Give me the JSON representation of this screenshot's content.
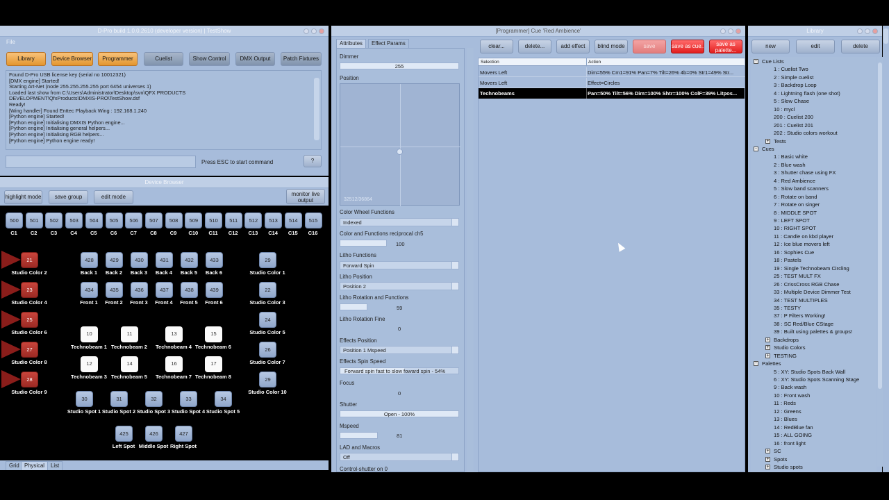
{
  "main_window": {
    "title": "D-Pro build 1.0.0.2610 (developer version) | TestShow",
    "menu_file": "File",
    "toolbar": [
      "Library",
      "Device Browser",
      "Programmer",
      "Cuelist",
      "Show Control",
      "DMX Output",
      "Patch Fixtures"
    ],
    "log": [
      "Found D-Pro USB license key (serial no 10012321)",
      "[DMX engine] Started!",
      "Starting Art-Net (node 255.255.255.255 port 6454 universes 1)",
      "Loaded last show from C:\\Users\\Administrator\\Desktop\\svn\\QFX PRODUCTS",
      "DEVELOPMENT\\QfxProducts\\DMXIS-PRO\\TestShow.dsf",
      "Ready!",
      "[Wing handler] Found Enttec Playback Wing : 192.168.1.240",
      "[Python engine] Started!",
      "[Python engine] Initialising DMXIS Python engine...",
      "[Python engine] Initialising general helpers...",
      "[Python engine] Initialising RGB helpers...",
      "[Python engine] Python engine ready!"
    ],
    "command_hint": "Press ESC to start command",
    "help_label": "?"
  },
  "device_browser": {
    "title": "Device Browser",
    "buttons": {
      "highlight": "highlight mode",
      "save_group": "save group",
      "edit_mode": "edit mode",
      "monitor": "monitor live output"
    },
    "top_row": [
      {
        "id": "500",
        "label": "C1"
      },
      {
        "id": "501",
        "label": "C2"
      },
      {
        "id": "502",
        "label": "C3"
      },
      {
        "id": "503",
        "label": "C4"
      },
      {
        "id": "504",
        "label": "C5"
      },
      {
        "id": "505",
        "label": "C6"
      },
      {
        "id": "506",
        "label": "C7"
      },
      {
        "id": "507",
        "label": "C8"
      },
      {
        "id": "508",
        "label": "C9"
      },
      {
        "id": "509",
        "label": "C10"
      },
      {
        "id": "510",
        "label": "C11"
      },
      {
        "id": "511",
        "label": "C12"
      },
      {
        "id": "512",
        "label": "C13"
      },
      {
        "id": "513",
        "label": "C14"
      },
      {
        "id": "514",
        "label": "C15"
      },
      {
        "id": "515",
        "label": "C16"
      }
    ],
    "left_col": [
      {
        "id": "21",
        "label": "Studio Color 2"
      },
      {
        "id": "23",
        "label": "Studio Color 4"
      },
      {
        "id": "25",
        "label": "Studio Color 6"
      },
      {
        "id": "27",
        "label": "Studio Color 8"
      },
      {
        "id": "28",
        "label": "Studio Color 9"
      }
    ],
    "back_row": [
      {
        "id": "428",
        "label": "Back 1"
      },
      {
        "id": "429",
        "label": "Back 2"
      },
      {
        "id": "430",
        "label": "Back 3"
      },
      {
        "id": "431",
        "label": "Back 4"
      },
      {
        "id": "432",
        "label": "Back 5"
      },
      {
        "id": "433",
        "label": "Back 6"
      }
    ],
    "front_row": [
      {
        "id": "434",
        "label": "Front 1"
      },
      {
        "id": "435",
        "label": "Front 2"
      },
      {
        "id": "436",
        "label": "Front 3"
      },
      {
        "id": "437",
        "label": "Front 4"
      },
      {
        "id": "438",
        "label": "Front 5"
      },
      {
        "id": "439",
        "label": "Front 6"
      }
    ],
    "right_col": [
      {
        "id": "29",
        "label": "Studio Color 1"
      },
      {
        "id": "22",
        "label": "Studio Color 3"
      },
      {
        "id": "24",
        "label": "Studio Color 5"
      },
      {
        "id": "26",
        "label": "Studio Color 7"
      },
      {
        "id": "29",
        "label": "Studio Color 10"
      }
    ],
    "techno_row1": [
      {
        "id": "10",
        "label": "Technobeam 1"
      },
      {
        "id": "11",
        "label": "Technobeam 2"
      },
      {
        "id": "13",
        "label": "Technobeam 4"
      },
      {
        "id": "15",
        "label": "Technobeam 6"
      }
    ],
    "techno_row2": [
      {
        "id": "12",
        "label": "Technobeam 3"
      },
      {
        "id": "14",
        "label": "Technobeam 5"
      },
      {
        "id": "16",
        "label": "Technobeam 7"
      },
      {
        "id": "17",
        "label": "Technobeam 8"
      }
    ],
    "spots": [
      {
        "id": "30",
        "label": "Studio Spot 1"
      },
      {
        "id": "31",
        "label": "Studio Spot 2"
      },
      {
        "id": "32",
        "label": "Studio Spot 3"
      },
      {
        "id": "33",
        "label": "Studio Spot 4"
      },
      {
        "id": "34",
        "label": "Studio Spot 5"
      }
    ],
    "lr_spots": [
      {
        "id": "425",
        "label": "Left Spot"
      },
      {
        "id": "426",
        "label": "Middle Spot"
      },
      {
        "id": "427",
        "label": "Right Spot"
      }
    ],
    "tabs": [
      "Grid",
      "Physical",
      "List"
    ]
  },
  "programmer": {
    "title": "[Programmer] Cue 'Red Ambience'",
    "tabs": [
      "Attributes",
      "Effect Params"
    ],
    "dimmer": {
      "label": "Dimmer",
      "value": "255"
    },
    "position": {
      "label": "Position",
      "readout": "32512/36864"
    },
    "color_wheel": {
      "label": "Color Wheel Functions",
      "value": "Indexed"
    },
    "color_recip": {
      "label": "Color and Functions reciprocal ch5",
      "value": "100",
      "fraction": 0.4
    },
    "litho_func": {
      "label": "Litho Functions",
      "value": "Forward Spin"
    },
    "litho_pos": {
      "label": "Litho Position",
      "value": "Position 2"
    },
    "litho_rot": {
      "label": "Litho Rotation and Functions",
      "value": "59",
      "fraction": 0.23
    },
    "litho_fine": {
      "label": "Litho Rotation Fine",
      "value": "0"
    },
    "effects_pos": {
      "label": "Effects Position",
      "value": "Position 1 Mspeed"
    },
    "effects_spin": {
      "label": "Effects Spin Speed",
      "value": "Forward spin fast to slow foward spin - 54%"
    },
    "focus": {
      "label": "Focus",
      "value": "0"
    },
    "shutter": {
      "label": "Shutter",
      "value": "Open - 100%"
    },
    "mspeed": {
      "label": "Mspeed",
      "value": "81",
      "fraction": 0.32
    },
    "lad": {
      "label": "LAD and Macros",
      "value": "Off"
    },
    "control_shutter": {
      "label": "Control-shutter on 0"
    },
    "buttons": [
      "clear...",
      "delete...",
      "add effect",
      "blind mode",
      "save",
      "save as cue...",
      "save as palette..."
    ],
    "table_headers": [
      "Selection",
      "Action"
    ],
    "rows": [
      {
        "selection": "Movers Left",
        "action": "Dim=55% Cm1=91% Pan=7% Tilt=26% 4b=0% Str1=49% Str..."
      },
      {
        "selection": "Movers Left",
        "action": "Effect=Circles"
      },
      {
        "selection": "Technobeams",
        "action": "Pan=50% Tilt=56% Dim=100% Shtr=100% ColF=39% Litpos..."
      }
    ]
  },
  "library": {
    "title": "Library",
    "buttons": [
      "new",
      "edit",
      "delete"
    ],
    "tree": [
      {
        "text": "Cue Lists",
        "level": 0,
        "expander": "-"
      },
      {
        "text": "1 : Cuelist Two",
        "level": 1
      },
      {
        "text": "2 : Simple cuelist",
        "level": 1
      },
      {
        "text": "3 : Backdrop Loop",
        "level": 1
      },
      {
        "text": "4 : Lightning flash (one shot)",
        "level": 1
      },
      {
        "text": "5 : Slow Chase",
        "level": 1
      },
      {
        "text": "10 : mycl",
        "level": 1
      },
      {
        "text": "200 : Cuelist 200",
        "level": 1
      },
      {
        "text": "201 : Cuelist 201",
        "level": 1
      },
      {
        "text": "202 : Studio colors workout",
        "level": 1
      },
      {
        "text": "Tests",
        "level": 1,
        "expander": "+"
      },
      {
        "text": "Cues",
        "level": 0,
        "expander": "-"
      },
      {
        "text": "1 : Basic white",
        "level": 1
      },
      {
        "text": "2 : Blue wash",
        "level": 1
      },
      {
        "text": "3 : Shutter chase using FX",
        "level": 1
      },
      {
        "text": "4 : Red Ambience",
        "level": 1
      },
      {
        "text": "5 : Slow band scanners",
        "level": 1
      },
      {
        "text": "6 : Rotate on band",
        "level": 1
      },
      {
        "text": "7 : Rotate on singer",
        "level": 1
      },
      {
        "text": "8 : MIDDLE SPOT",
        "level": 1
      },
      {
        "text": "9 : LEFT SPOT",
        "level": 1
      },
      {
        "text": "10 : RIGHT SPOT",
        "level": 1
      },
      {
        "text": "11 : Candle on kbd player",
        "level": 1
      },
      {
        "text": "12 : Ice blue movers left",
        "level": 1
      },
      {
        "text": "16 : Sophies Cue",
        "level": 1
      },
      {
        "text": "18 : Pastels",
        "level": 1
      },
      {
        "text": "19 : Single Technobeam Circling",
        "level": 1
      },
      {
        "text": "25 : TEST MULT FX",
        "level": 1
      },
      {
        "text": "26 : CrissCross RGB Chase",
        "level": 1
      },
      {
        "text": "33 : Multiple Device Dimmer Test",
        "level": 1
      },
      {
        "text": "34 : TEST MULTIPLES",
        "level": 1
      },
      {
        "text": "35 : TESTY",
        "level": 1
      },
      {
        "text": "37 : P Filters Working!",
        "level": 1
      },
      {
        "text": "38 : SC Red/Blue CStage",
        "level": 1
      },
      {
        "text": "39 : Built using palettes & groups!",
        "level": 1
      },
      {
        "text": "Backdrops",
        "level": 1,
        "expander": "+"
      },
      {
        "text": "Studio Colors",
        "level": 1,
        "expander": "+"
      },
      {
        "text": "TESTING",
        "level": 1,
        "expander": "+"
      },
      {
        "text": "Palettes",
        "level": 0,
        "expander": "-"
      },
      {
        "text": "5 : XY: Studio Spots Back Wall",
        "level": 1
      },
      {
        "text": "6 : XY: Studio Spots Scanning Stage",
        "level": 1
      },
      {
        "text": "9 : Back wash",
        "level": 1
      },
      {
        "text": "10 : Front wash",
        "level": 1
      },
      {
        "text": "11 : Reds",
        "level": 1
      },
      {
        "text": "12 : Greens",
        "level": 1
      },
      {
        "text": "13 : Blues",
        "level": 1
      },
      {
        "text": "14 : RedBlue fan",
        "level": 1
      },
      {
        "text": "15 : ALL GOING",
        "level": 1
      },
      {
        "text": "16 : front light",
        "level": 1
      },
      {
        "text": "SC",
        "level": 1,
        "expander": "+"
      },
      {
        "text": "Spots",
        "level": 1,
        "expander": "+"
      },
      {
        "text": "Studio spots",
        "level": 1,
        "expander": "+"
      }
    ]
  }
}
